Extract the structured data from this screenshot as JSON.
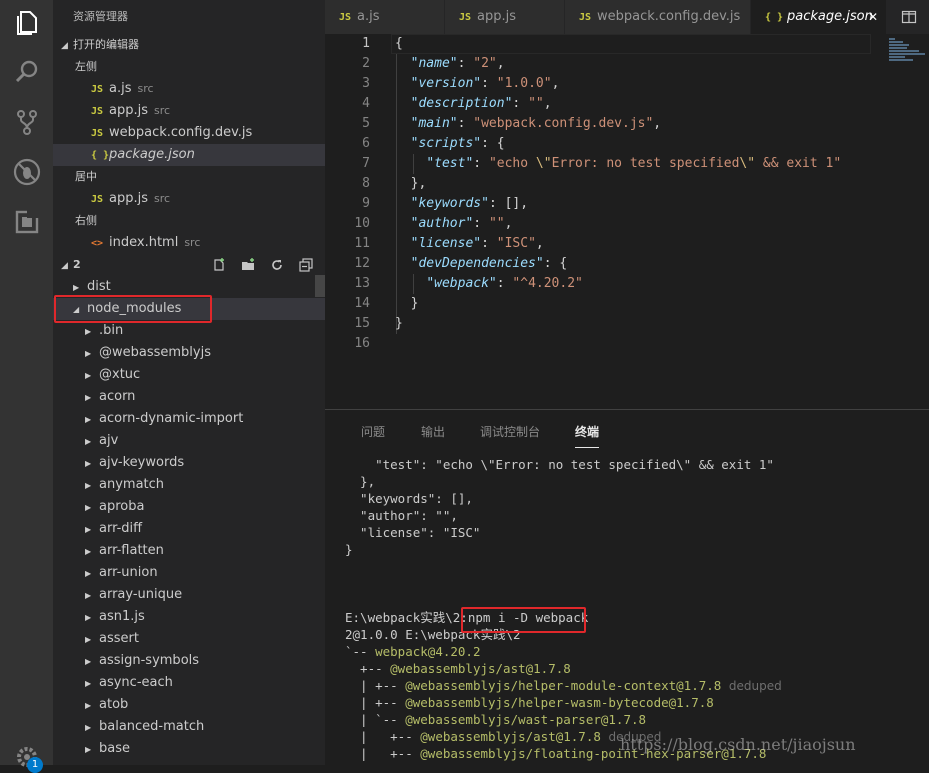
{
  "explorer": {
    "title": "资源管理器",
    "open_editors": {
      "label": "打开的编辑器",
      "groups": [
        {
          "label": "左侧",
          "items": [
            {
              "name": "a.js",
              "desc": "src",
              "icon": "JS"
            },
            {
              "name": "app.js",
              "desc": "src",
              "icon": "JS"
            },
            {
              "name": "webpack.config.dev.js",
              "desc": "",
              "icon": "JS"
            },
            {
              "name": "package.json",
              "desc": "",
              "icon": "{ }"
            }
          ]
        },
        {
          "label": "居中",
          "items": [
            {
              "name": "app.js",
              "desc": "src",
              "icon": "JS"
            }
          ]
        },
        {
          "label": "右侧",
          "items": [
            {
              "name": "index.html",
              "desc": "src",
              "icon": "<>"
            }
          ]
        }
      ]
    },
    "folder": {
      "name": "2",
      "items": [
        "dist",
        "node_modules"
      ],
      "node_modules_children": [
        ".bin",
        "@webassemblyjs",
        "@xtuc",
        "acorn",
        "acorn-dynamic-import",
        "ajv",
        "ajv-keywords",
        "anymatch",
        "aproba",
        "arr-diff",
        "arr-flatten",
        "arr-union",
        "array-unique",
        "asn1.js",
        "assert",
        "assign-symbols",
        "async-each",
        "atob",
        "balanced-match",
        "base"
      ]
    }
  },
  "badge_count": "1",
  "tabs": [
    {
      "label": "a.js",
      "icon": "JS"
    },
    {
      "label": "app.js",
      "icon": "JS"
    },
    {
      "label": "webpack.config.dev.js",
      "icon": "JS"
    },
    {
      "label": "package.json",
      "icon": "{ }",
      "close": "✕"
    }
  ],
  "editor": {
    "lines": [
      "{",
      "  \"name\": \"2\",",
      "  \"version\": \"1.0.0\",",
      "  \"description\": \"\",",
      "  \"main\": \"webpack.config.dev.js\",",
      "  \"scripts\": {",
      "    \"test\": \"echo \\\"Error: no test specified\\\" && exit 1\"",
      "  },",
      "  \"keywords\": [],",
      "  \"author\": \"\",",
      "  \"license\": \"ISC\",",
      "  \"devDependencies\": {",
      "    \"webpack\": \"^4.20.2\"",
      "  }",
      "}",
      ""
    ]
  },
  "panel": {
    "tabs": [
      "问题",
      "输出",
      "调试控制台",
      "终端"
    ],
    "terminal": [
      {
        "text": "    \"test\": \"echo \\\"Error: no test specified\\\" && exit 1\""
      },
      {
        "text": "  },"
      },
      {
        "text": "  \"keywords\": [],"
      },
      {
        "text": "  \"author\": \"\","
      },
      {
        "text": "  \"license\": \"ISC\""
      },
      {
        "text": "}"
      },
      {
        "text": ""
      },
      {
        "text": ""
      },
      {
        "text": ""
      },
      {
        "prompt": "E:\\webpack实践\\2:",
        "command": "npm i -D webpack"
      },
      {
        "text": "2@1.0.0 E:\\webpack实践\\2"
      },
      {
        "prefix": "`-- ",
        "pkg": "webpack@4.20.2"
      },
      {
        "prefix": "  +-- ",
        "pkg": "@webassemblyjs/ast@1.7.8"
      },
      {
        "prefix": "  | +-- ",
        "pkg": "@webassemblyjs/helper-module-context@1.7.8",
        "note": "deduped"
      },
      {
        "prefix": "  | +-- ",
        "pkg": "@webassemblyjs/helper-wasm-bytecode@1.7.8"
      },
      {
        "prefix": "  | `-- ",
        "pkg": "@webassemblyjs/wast-parser@1.7.8"
      },
      {
        "prefix": "  |   +-- ",
        "pkg": "@webassemblyjs/ast@1.7.8",
        "note": "deduped"
      },
      {
        "prefix": "  |   +-- ",
        "pkg": "@webassemblyjs/floating-point-hex-parser@1.7.8"
      }
    ]
  },
  "watermark": "https://blog.csdn.net/jiaojsun"
}
